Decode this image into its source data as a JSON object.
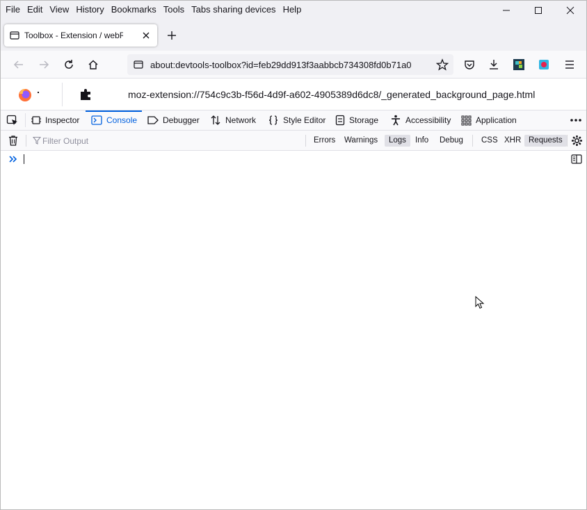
{
  "menubar": {
    "items": [
      "File",
      "Edit",
      "View",
      "History",
      "Bookmarks",
      "Tools",
      "Tabs sharing devices",
      "Help"
    ]
  },
  "tab": {
    "title": "Toolbox - Extension / webRequest"
  },
  "urlbar": {
    "url": "about:devtools-toolbox?id=feb29dd913f3aabbcb734308fd0b71a0"
  },
  "target": {
    "url": "moz-extension://754c9c3b-f56d-4d9f-a602-4905389d6dc8/_generated_background_page.html"
  },
  "devtools_tabs": [
    {
      "label": "Inspector",
      "selected": false
    },
    {
      "label": "Console",
      "selected": true
    },
    {
      "label": "Debugger",
      "selected": false
    },
    {
      "label": "Network",
      "selected": false
    },
    {
      "label": "Style Editor",
      "selected": false
    },
    {
      "label": "Storage",
      "selected": false
    },
    {
      "label": "Accessibility",
      "selected": false
    },
    {
      "label": "Application",
      "selected": false
    }
  ],
  "console_toolbar": {
    "filter_placeholder": "Filter Output",
    "levels": [
      "Errors",
      "Warnings",
      "Logs",
      "Info",
      "Debug"
    ],
    "types": [
      "CSS",
      "XHR",
      "Requests"
    ],
    "active": [
      "Logs",
      "Requests"
    ]
  },
  "colors": {
    "accent": "#0060df",
    "chrome_bg": "#f0f0f4",
    "toolbar_bg": "#f9f9fb"
  }
}
